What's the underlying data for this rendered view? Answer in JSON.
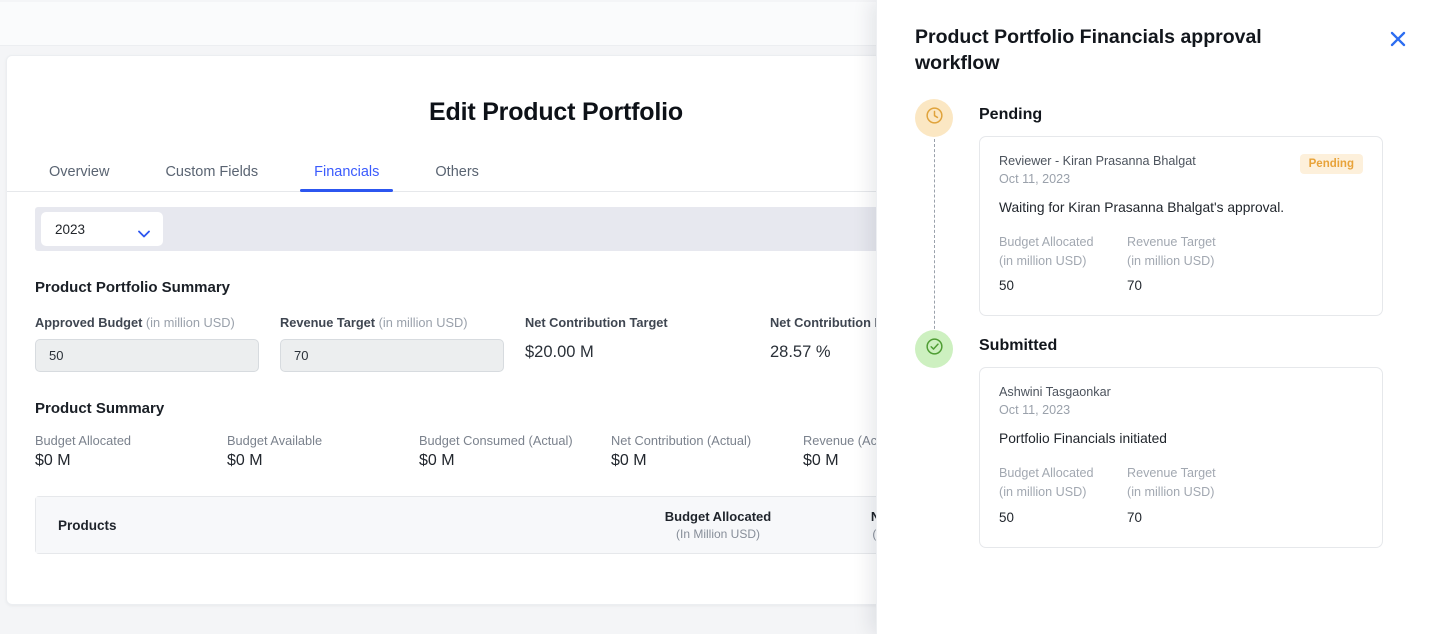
{
  "main": {
    "title": "Edit Product Portfolio",
    "tabs": [
      {
        "label": "Overview",
        "active": false
      },
      {
        "label": "Custom Fields",
        "active": false
      },
      {
        "label": "Financials",
        "active": true
      },
      {
        "label": "Others",
        "active": false
      }
    ],
    "year_selector": {
      "value": "2023",
      "icon": "chevron-down-icon"
    },
    "portfolio_summary": {
      "title": "Product Portfolio Summary",
      "fields": [
        {
          "label": "Approved Budget",
          "unit": "(in million USD)",
          "value": "50",
          "type": "input"
        },
        {
          "label": "Revenue Target",
          "unit": "(in million USD)",
          "value": "70",
          "type": "input"
        },
        {
          "label": "Net Contribution Target",
          "unit": "",
          "value": "$20.00 M",
          "type": "stat"
        },
        {
          "label": "Net Contribution P",
          "unit": "",
          "value": "28.57 %",
          "type": "stat"
        }
      ]
    },
    "product_summary": {
      "title": "Product Summary",
      "items": [
        {
          "label": "Budget Allocated",
          "value": "$0 M"
        },
        {
          "label": "Budget Available",
          "value": "$0 M"
        },
        {
          "label": "Budget Consumed (Actual)",
          "value": "$0 M"
        },
        {
          "label": "Net Contribution (Actual)",
          "value": "$0 M"
        },
        {
          "label": "Revenue (Ac",
          "value": "$0 M"
        }
      ]
    },
    "table": {
      "columns": [
        {
          "label": "Products",
          "sub": ""
        },
        {
          "label": "Budget Allocated",
          "sub": "(In Million USD)"
        },
        {
          "label": "Net Cont",
          "sub": "(In Million"
        }
      ]
    }
  },
  "drawer": {
    "title": "Product Portfolio Financials approval workflow",
    "close_icon": "close-icon",
    "steps": [
      {
        "heading": "Pending",
        "icon": "clock-icon",
        "who": "Reviewer - Kiran Prasanna Bhalgat",
        "when": "Oct 11, 2023",
        "badge": "Pending",
        "message": "Waiting for Kiran Prasanna Bhalgat's approval.",
        "metrics": [
          {
            "label": "Budget Allocated",
            "unit": "(in million USD)",
            "value": "50"
          },
          {
            "label": "Revenue Target",
            "unit": "(in million USD)",
            "value": "70"
          }
        ]
      },
      {
        "heading": "Submitted",
        "icon": "check-circle-icon",
        "who": "Ashwini Tasgaonkar",
        "when": "Oct 11, 2023",
        "badge": "",
        "message": "Portfolio Financials initiated",
        "metrics": [
          {
            "label": "Budget Allocated",
            "unit": "(in million USD)",
            "value": "50"
          },
          {
            "label": "Revenue Target",
            "unit": "(in million USD)",
            "value": "70"
          }
        ]
      }
    ]
  },
  "colors": {
    "accent": "#2c56f0",
    "pending": "#e8a33a",
    "success": "#52a832",
    "band": "#e7e8ef"
  }
}
